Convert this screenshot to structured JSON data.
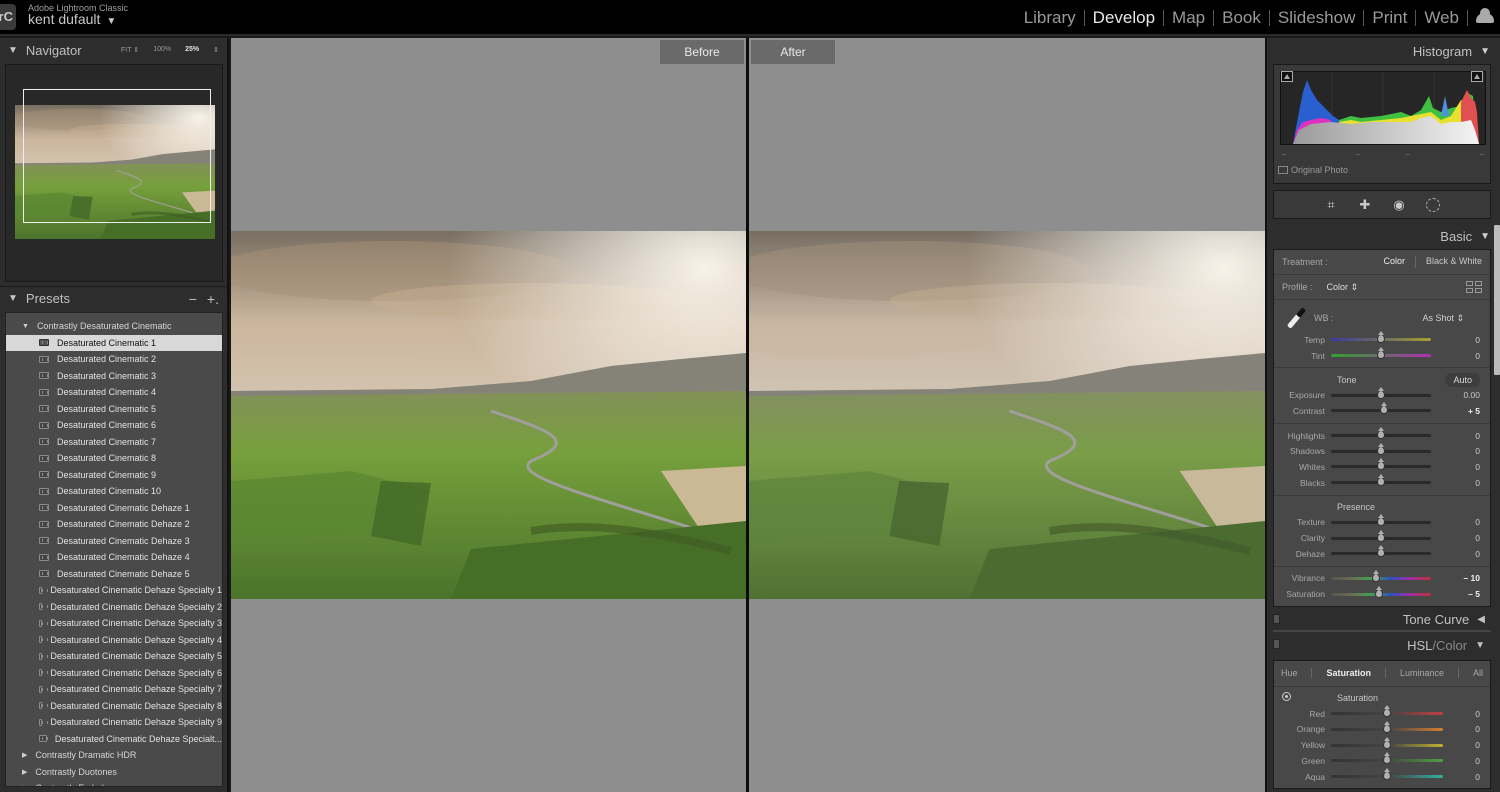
{
  "app": {
    "logo": "Lrc",
    "title": "Adobe Lightroom Classic",
    "user": "kent dufault",
    "modules": [
      "Library",
      "Develop",
      "Map",
      "Book",
      "Slideshow",
      "Print",
      "Web"
    ],
    "active_module": "Develop"
  },
  "navigator": {
    "title": "Navigator",
    "zoom_options": [
      "FIT ⇕",
      "100%",
      "25%"
    ],
    "selected_zoom": "25%",
    "zoom_stepper": "⇕"
  },
  "presets": {
    "title": "Presets",
    "remove_label": "−",
    "add_label": "+.",
    "open_folder": "Contrastly Desaturated Cinematic",
    "items": [
      "Desaturated Cinematic 1",
      "Desaturated Cinematic 2",
      "Desaturated Cinematic 3",
      "Desaturated Cinematic 4",
      "Desaturated Cinematic 5",
      "Desaturated Cinematic 6",
      "Desaturated Cinematic 7",
      "Desaturated Cinematic 8",
      "Desaturated Cinematic 9",
      "Desaturated Cinematic 10",
      "Desaturated Cinematic Dehaze 1",
      "Desaturated Cinematic Dehaze 2",
      "Desaturated Cinematic Dehaze 3",
      "Desaturated Cinematic Dehaze 4",
      "Desaturated Cinematic Dehaze 5",
      "Desaturated Cinematic Dehaze Specialty 1",
      "Desaturated Cinematic Dehaze Specialty 2",
      "Desaturated Cinematic Dehaze Specialty 3",
      "Desaturated Cinematic Dehaze Specialty 4",
      "Desaturated Cinematic Dehaze Specialty 5",
      "Desaturated Cinematic Dehaze Specialty 6",
      "Desaturated Cinematic Dehaze Specialty 7",
      "Desaturated Cinematic Dehaze Specialty 8",
      "Desaturated Cinematic Dehaze Specialty 9",
      "Desaturated Cinematic Dehaze Specialt..."
    ],
    "selected_item": "Desaturated Cinematic 1",
    "closed_folders": [
      "Contrastly Dramatic HDR",
      "Contrastly Duotones",
      "Contrastly Faded"
    ]
  },
  "compare": {
    "before_label": "Before",
    "after_label": "After"
  },
  "histogram": {
    "title": "Histogram",
    "original_photo_label": "Original Photo",
    "tools": [
      "crop-icon",
      "healing-icon",
      "red-eye-icon",
      "masking-icon"
    ]
  },
  "basic": {
    "title": "Basic",
    "treatment_label": "Treatment :",
    "treatment_options": [
      "Color",
      "Black & White"
    ],
    "treatment_selected": "Color",
    "profile_label": "Profile :",
    "profile_value": "Color ⇕",
    "wb_label": "WB :",
    "wb_value": "As Shot ⇕",
    "wb_sliders": [
      {
        "label": "Temp",
        "value": "0",
        "position": 0.5,
        "track": "linear-gradient(90deg,#3a3aa0,#6a6a60,#a8a030)"
      },
      {
        "label": "Tint",
        "value": "0",
        "position": 0.5,
        "track": "linear-gradient(90deg,#30a030,#6a6a6a,#b030b0)"
      }
    ],
    "tone_title": "Tone",
    "auto_label": "Auto",
    "tone_sliders": [
      {
        "label": "Exposure",
        "value": "0.00",
        "position": 0.5
      },
      {
        "label": "Contrast",
        "value": "+ 5",
        "position": 0.525,
        "bright": true
      }
    ],
    "tone_sliders_2": [
      {
        "label": "Highlights",
        "value": "0",
        "position": 0.5
      },
      {
        "label": "Shadows",
        "value": "0",
        "position": 0.5
      },
      {
        "label": "Whites",
        "value": "0",
        "position": 0.5
      },
      {
        "label": "Blacks",
        "value": "0",
        "position": 0.5
      }
    ],
    "presence_title": "Presence",
    "presence_sliders": [
      {
        "label": "Texture",
        "value": "0",
        "position": 0.5
      },
      {
        "label": "Clarity",
        "value": "0",
        "position": 0.5
      },
      {
        "label": "Dehaze",
        "value": "0",
        "position": 0.5
      }
    ],
    "color_sliders": [
      {
        "label": "Vibrance",
        "value": "– 10",
        "position": 0.45,
        "bright": true,
        "track": "linear-gradient(90deg,#555,#6a6a50,#40a050,#3050c0,#a030a0,#c03040)"
      },
      {
        "label": "Saturation",
        "value": "– 5",
        "position": 0.475,
        "bright": true,
        "track": "linear-gradient(90deg,#555,#6a6a50,#40a050,#3050c0,#a030a0,#c03040)"
      }
    ]
  },
  "tone_curve": {
    "title": "Tone Curve"
  },
  "hsl": {
    "title_main": "HSL",
    "title_sep": " / ",
    "title_sub": "Color",
    "tabs": [
      "Hue",
      "Saturation",
      "Luminance",
      "All"
    ],
    "active_tab": "Saturation",
    "section_title": "Saturation",
    "sliders": [
      {
        "label": "Red",
        "value": "0",
        "position": 0.5,
        "track": "linear-gradient(90deg,#333 0%,#444 50%,#c04040 100%)"
      },
      {
        "label": "Orange",
        "value": "0",
        "position": 0.5,
        "track": "linear-gradient(90deg,#333 0%,#444 50%,#d08030 100%)"
      },
      {
        "label": "Yellow",
        "value": "0",
        "position": 0.5,
        "track": "linear-gradient(90deg,#333 0%,#444 50%,#c0b030 100%)"
      },
      {
        "label": "Green",
        "value": "0",
        "position": 0.5,
        "track": "linear-gradient(90deg,#333 0%,#444 50%,#50a040 100%)"
      },
      {
        "label": "Aqua",
        "value": "0",
        "position": 0.5,
        "track": "linear-gradient(90deg,#333 0%,#444 50%,#30b0a0 100%)"
      }
    ]
  }
}
